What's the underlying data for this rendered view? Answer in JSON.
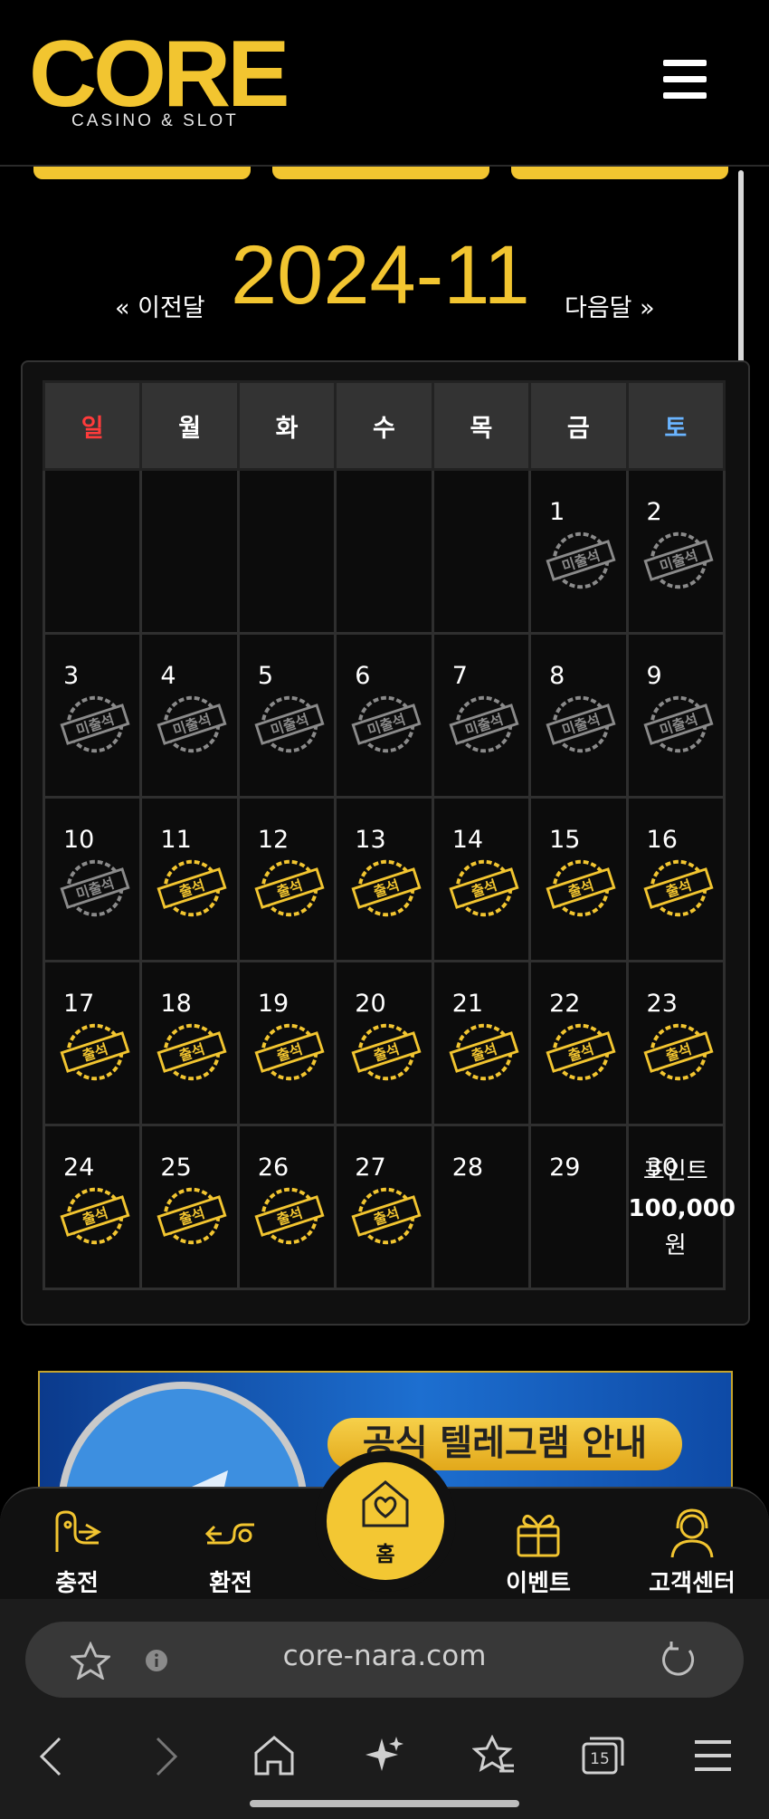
{
  "header": {
    "logo_text": "CORE",
    "logo_subtitle": "CASINO & SLOT",
    "menu_icon": "hamburger-menu-icon"
  },
  "month_nav": {
    "prev_label": "« 이전달",
    "title": "2024-11",
    "next_label": "다음달 »"
  },
  "calendar": {
    "weekdays": [
      {
        "label": "일",
        "color": "#ff3b3b"
      },
      {
        "label": "월",
        "color": "#ffffff"
      },
      {
        "label": "화",
        "color": "#ffffff"
      },
      {
        "label": "수",
        "color": "#ffffff"
      },
      {
        "label": "목",
        "color": "#ffffff"
      },
      {
        "label": "금",
        "color": "#ffffff"
      },
      {
        "label": "토",
        "color": "#6ab4ff"
      }
    ],
    "weeks": [
      [
        {
          "day": ""
        },
        {
          "day": ""
        },
        {
          "day": ""
        },
        {
          "day": ""
        },
        {
          "day": ""
        },
        {
          "day": "1",
          "stamp": "미출석"
        },
        {
          "day": "2",
          "stamp": "미출석"
        }
      ],
      [
        {
          "day": "3",
          "stamp": "미출석"
        },
        {
          "day": "4",
          "stamp": "미출석"
        },
        {
          "day": "5",
          "stamp": "미출석"
        },
        {
          "day": "6",
          "stamp": "미출석"
        },
        {
          "day": "7",
          "stamp": "미출석"
        },
        {
          "day": "8",
          "stamp": "미출석"
        },
        {
          "day": "9",
          "stamp": "미출석"
        }
      ],
      [
        {
          "day": "10",
          "stamp": "미출석"
        },
        {
          "day": "11",
          "stamp": "출석"
        },
        {
          "day": "12",
          "stamp": "출석"
        },
        {
          "day": "13",
          "stamp": "출석"
        },
        {
          "day": "14",
          "stamp": "출석"
        },
        {
          "day": "15",
          "stamp": "출석"
        },
        {
          "day": "16",
          "stamp": "출석"
        }
      ],
      [
        {
          "day": "17",
          "stamp": "출석"
        },
        {
          "day": "18",
          "stamp": "출석"
        },
        {
          "day": "19",
          "stamp": "출석"
        },
        {
          "day": "20",
          "stamp": "출석"
        },
        {
          "day": "21",
          "stamp": "출석"
        },
        {
          "day": "22",
          "stamp": "출석"
        },
        {
          "day": "23",
          "stamp": "출석"
        }
      ],
      [
        {
          "day": "24",
          "stamp": "출석"
        },
        {
          "day": "25",
          "stamp": "출석"
        },
        {
          "day": "26",
          "stamp": "출석"
        },
        {
          "day": "27",
          "stamp": "출석"
        },
        {
          "day": "28"
        },
        {
          "day": "29"
        },
        {
          "day": "30",
          "reward": {
            "line1": "포인트",
            "amount": "100,000",
            "unit": "원"
          }
        }
      ]
    ],
    "stamp_colors": {
      "absent": "#8a8a8a",
      "present": "#f2c530"
    }
  },
  "banner": {
    "text": "공식 텔레그램 안내",
    "icon": "telegram-icon"
  },
  "bottom_nav": {
    "items": [
      {
        "label": "충전",
        "icon": "deposit-icon"
      },
      {
        "label": "환전",
        "icon": "withdraw-icon"
      },
      {
        "label": "홈",
        "icon": "home-heart-icon"
      },
      {
        "label": "이벤트",
        "icon": "gift-icon"
      },
      {
        "label": "고객센터",
        "icon": "support-icon"
      }
    ]
  },
  "browser": {
    "url": "core-nara.com",
    "tab_count": "15"
  },
  "colors": {
    "accent": "#f2c530",
    "background": "#000000"
  }
}
